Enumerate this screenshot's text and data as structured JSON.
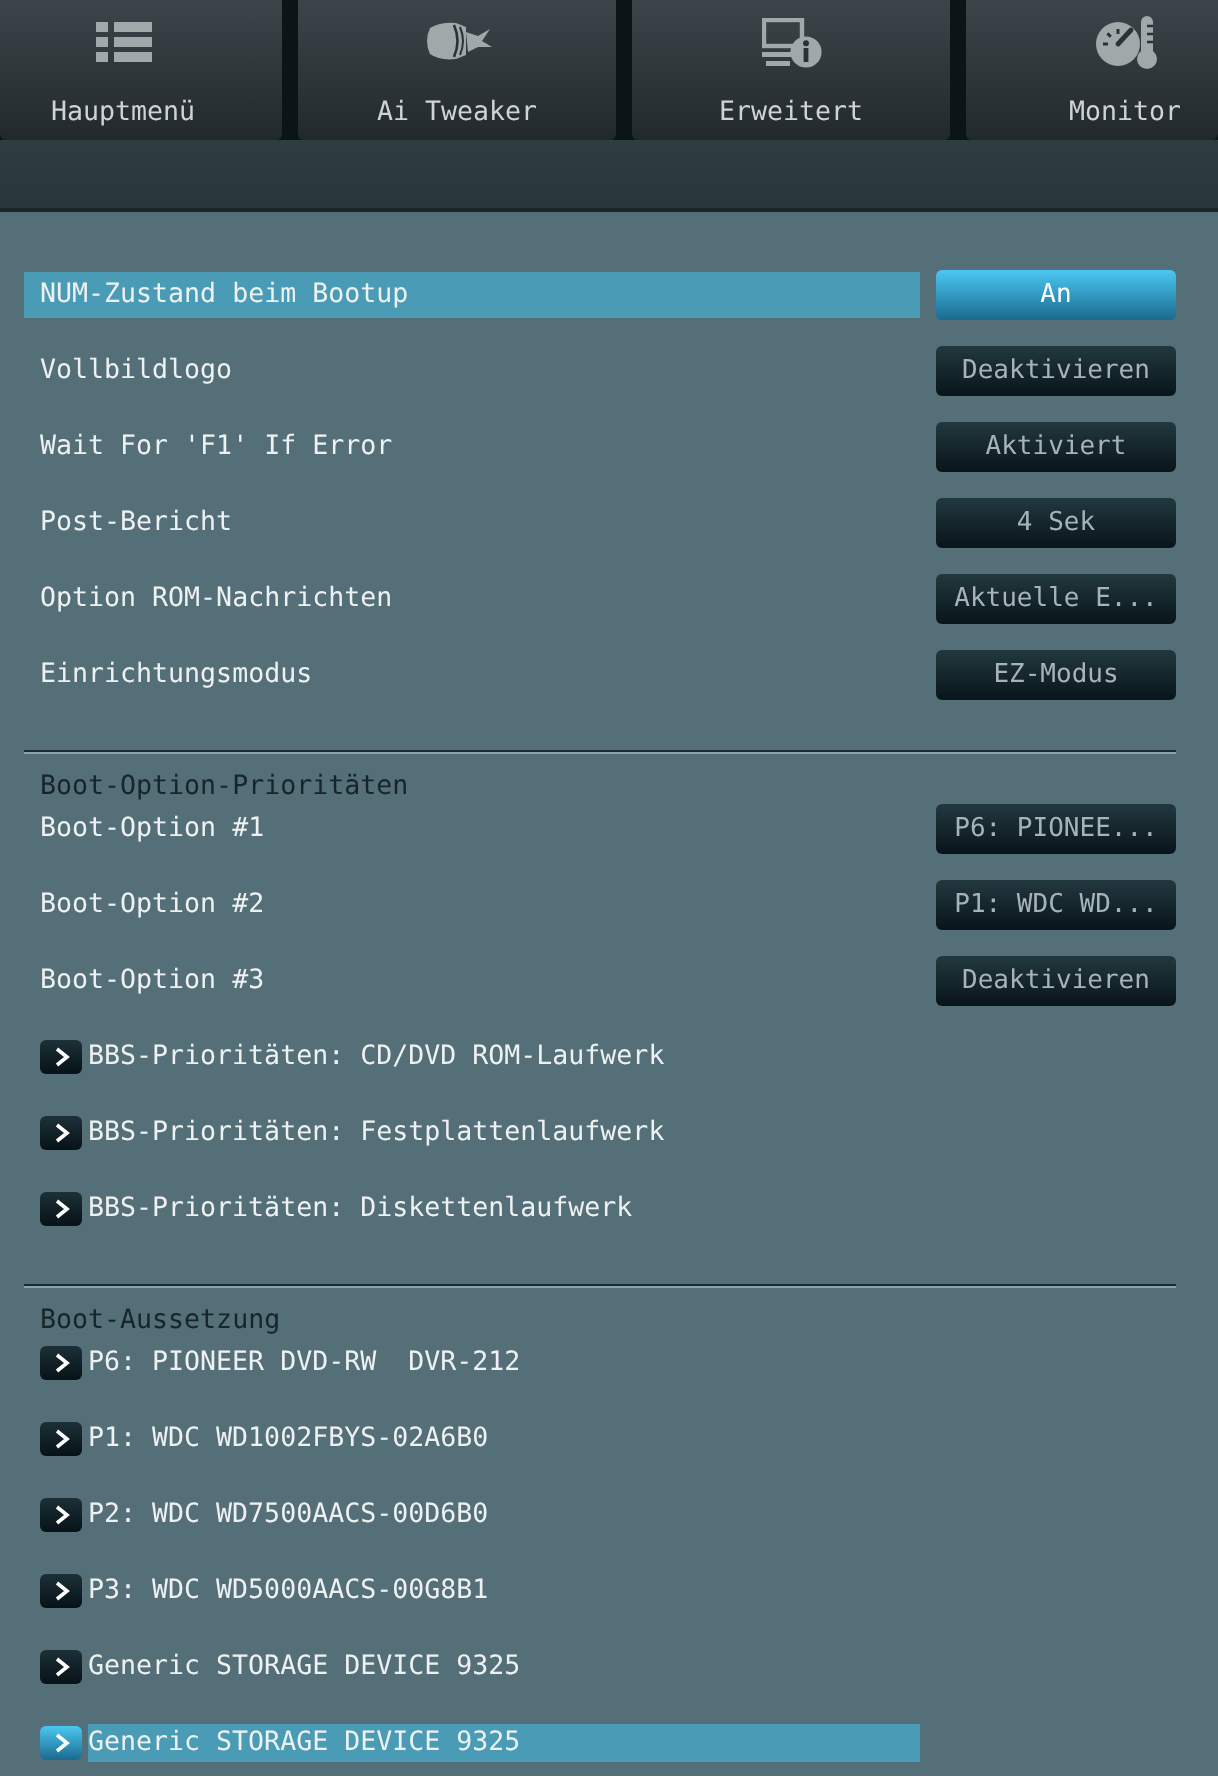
{
  "tabs": [
    {
      "label": "Hauptmenü",
      "selected": false
    },
    {
      "label": "Ai Tweaker",
      "selected": false
    },
    {
      "label": "Erweitert",
      "selected": false
    },
    {
      "label": "Monitor",
      "selected": false
    }
  ],
  "settings": [
    {
      "label": "NUM-Zustand beim Bootup",
      "value": "An",
      "selected": true
    },
    {
      "label": "Vollbildlogo",
      "value": "Deaktivieren",
      "selected": false
    },
    {
      "label": "Wait For 'F1' If Error",
      "value": "Aktiviert",
      "selected": false
    },
    {
      "label": "Post-Bericht",
      "value": "4 Sek",
      "selected": false
    },
    {
      "label": "Option ROM-Nachrichten",
      "value": "Aktuelle E...",
      "selected": false
    },
    {
      "label": "Einrichtungsmodus",
      "value": "EZ-Modus",
      "selected": false
    }
  ],
  "boot_priorities": {
    "heading": "Boot-Option-Prioritäten",
    "options": [
      {
        "label": "Boot-Option #1",
        "value": "P6: PIONEE...",
        "selected": false
      },
      {
        "label": "Boot-Option #2",
        "value": "P1: WDC WD...",
        "selected": false
      },
      {
        "label": "Boot-Option #3",
        "value": "Deaktivieren",
        "selected": false
      }
    ],
    "submenus": [
      {
        "label": "BBS-Prioritäten: CD/DVD ROM-Laufwerk",
        "selected": false
      },
      {
        "label": "BBS-Prioritäten: Festplattenlaufwerk",
        "selected": false
      },
      {
        "label": "BBS-Prioritäten: Diskettenlaufwerk",
        "selected": false
      }
    ]
  },
  "boot_override": {
    "heading": "Boot-Aussetzung",
    "items": [
      {
        "label": "P6: PIONEER DVD-RW  DVR-212",
        "selected": false
      },
      {
        "label": "P1: WDC WD1002FBYS-02A6B0",
        "selected": false
      },
      {
        "label": "P2: WDC WD7500AACS-00D6B0",
        "selected": false
      },
      {
        "label": "P3: WDC WD5000AACS-00G8B1",
        "selected": false
      },
      {
        "label": "Generic STORAGE DEVICE 9325",
        "selected": false
      },
      {
        "label": "Generic STORAGE DEVICE 9325",
        "selected": true
      }
    ]
  }
}
